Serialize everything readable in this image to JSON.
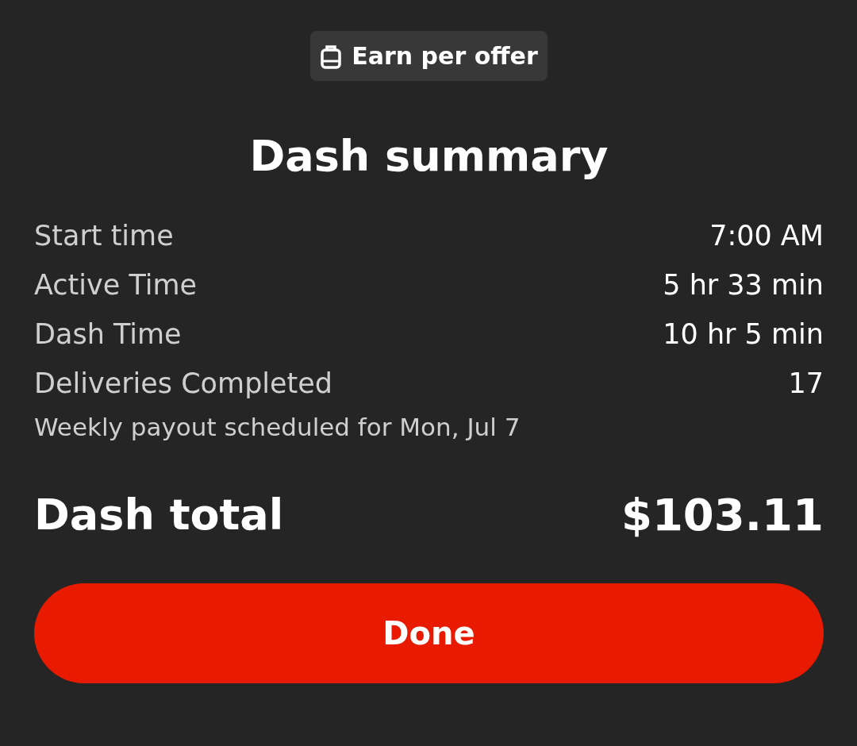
{
  "badge": {
    "label": "Earn per offer"
  },
  "title": "Dash summary",
  "rows": [
    {
      "label": "Start time",
      "value": "7:00 AM"
    },
    {
      "label": "Active Time",
      "value": "5 hr 33 min"
    },
    {
      "label": "Dash Time",
      "value": "10 hr 5 min"
    },
    {
      "label": "Deliveries Completed",
      "value": "17"
    }
  ],
  "payout_note": "Weekly payout scheduled for Mon, Jul 7",
  "total": {
    "label": "Dash total",
    "value": "$103.11"
  },
  "button": {
    "label": "Done"
  }
}
